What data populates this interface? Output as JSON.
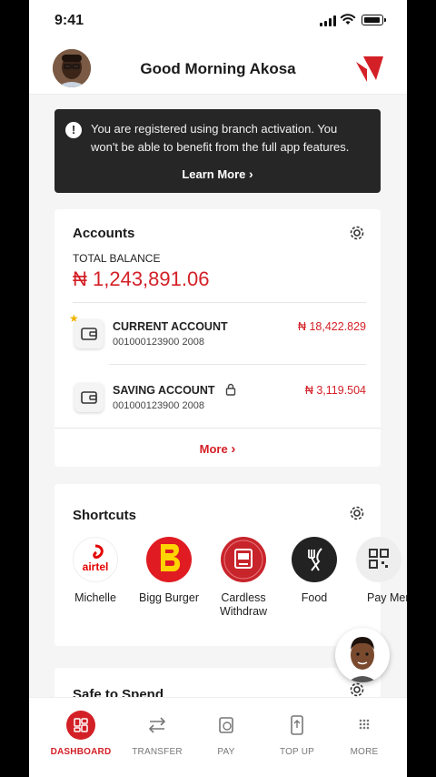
{
  "status_bar": {
    "time": "9:41"
  },
  "header": {
    "greeting": "Good Morning Akosa"
  },
  "notice": {
    "message": "You are registered using branch activation. You won't be able to benefit from the full app features.",
    "learn_more": "Learn More"
  },
  "accounts": {
    "title": "Accounts",
    "total_label": "TOTAL BALANCE",
    "total_value": "₦ 1,243,891.06",
    "items": [
      {
        "name": "CURRENT ACCOUNT",
        "number": "001000123900 2008",
        "amount": "₦ 18,422.829",
        "favorite": true
      },
      {
        "name": "SAVING ACCOUNT",
        "number": "001000123900 2008",
        "amount": "₦ 3,119.504",
        "locked": true
      }
    ],
    "more": "More"
  },
  "shortcuts": {
    "title": "Shortcuts",
    "items": [
      {
        "label": "Michelle",
        "icon": "airtel-logo",
        "icon_text": "airtel"
      },
      {
        "label": "Bigg Burger",
        "icon": "bigg-burger-logo"
      },
      {
        "label": "Cardless Withdraw",
        "icon": "atm-icon"
      },
      {
        "label": "Food",
        "icon": "fork-knife-icon"
      },
      {
        "label": "Pay Merch",
        "icon": "qr-icon"
      }
    ]
  },
  "safe_to_spend": {
    "title": "Safe to Spend"
  },
  "nav": {
    "items": [
      {
        "label": "DASHBOARD",
        "icon": "dashboard-icon",
        "active": true
      },
      {
        "label": "TRANSFER",
        "icon": "transfer-icon"
      },
      {
        "label": "PAY",
        "icon": "pay-icon"
      },
      {
        "label": "TOP UP",
        "icon": "top-up-icon"
      },
      {
        "label": "MORE",
        "icon": "more-dots-icon"
      }
    ]
  },
  "colors": {
    "brand": "#d32027",
    "notice_bg": "#262626",
    "favorite_star": "#f2b400"
  }
}
